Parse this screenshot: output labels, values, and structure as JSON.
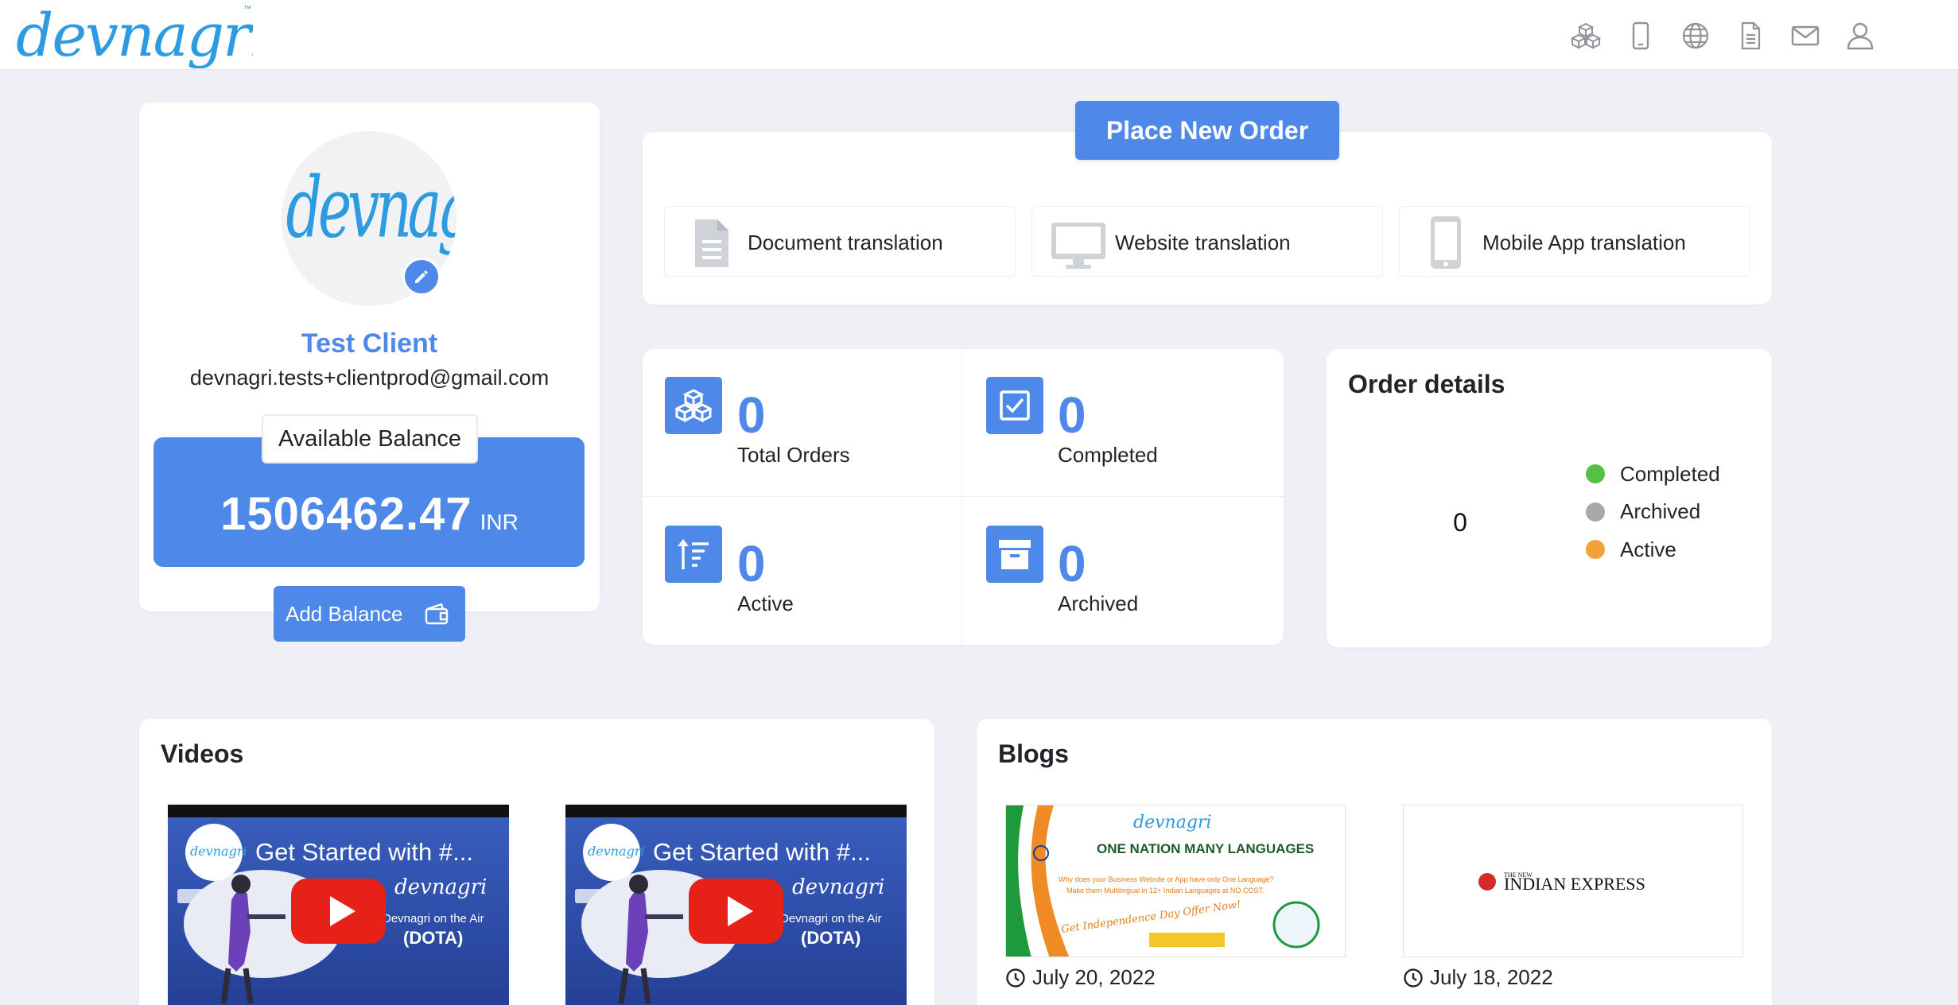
{
  "header": {
    "logo_text": "devnagri",
    "icons": [
      "cubes-icon",
      "mobile-icon",
      "globe-icon",
      "document-icon",
      "mail-icon",
      "user-icon"
    ]
  },
  "profile": {
    "avatar_text": "devnagri",
    "name": "Test Client",
    "email": "devnagri.tests+clientprod@gmail.com",
    "balance_label": "Available Balance",
    "balance": "1506462.47",
    "currency": "INR",
    "add_balance": "Add Balance"
  },
  "order": {
    "place_button": "Place New Order",
    "options": [
      {
        "label": "Document translation",
        "icon": "document-icon"
      },
      {
        "label": "Website translation",
        "icon": "monitor-icon"
      },
      {
        "label": "Mobile App translation",
        "icon": "mobile-icon"
      }
    ]
  },
  "stats": [
    {
      "value": "0",
      "label": "Total Orders",
      "icon": "cubes-icon"
    },
    {
      "value": "0",
      "label": "Completed",
      "icon": "checkbox-icon"
    },
    {
      "value": "0",
      "label": "Active",
      "icon": "sort-icon"
    },
    {
      "value": "0",
      "label": "Archived",
      "icon": "archive-icon"
    }
  ],
  "order_details": {
    "title": "Order details",
    "total": "0",
    "legend": [
      {
        "label": "Completed",
        "color": "#55c142"
      },
      {
        "label": "Archived",
        "color": "#a9a9a9"
      },
      {
        "label": "Active",
        "color": "#f4a13a"
      }
    ]
  },
  "videos": {
    "title": "Videos",
    "items": [
      {
        "title": "Get Started with #...",
        "brand": "devnagri",
        "caption": "Devnagri on the Air",
        "tag": "(DOTA)"
      },
      {
        "title": "Get Started with #...",
        "brand": "devnagri",
        "caption": "Devnagri on the Air",
        "tag": "(DOTA)"
      }
    ]
  },
  "blogs": {
    "title": "Blogs",
    "items": [
      {
        "brand": "devnagri",
        "headline": "ONE NATION MANY LANGUAGES",
        "sub1": "Why does your Business Website or App have only One Language?",
        "sub2": "Make them Multilingual in 12+ Indian Languages at NO COST.",
        "promo": "Get Independence Day Offer Now!",
        "date": "July 20, 2022"
      },
      {
        "masthead_small": "THE NEW",
        "masthead": "INDIAN EXPRESS",
        "date": "July 18, 2022"
      }
    ]
  }
}
